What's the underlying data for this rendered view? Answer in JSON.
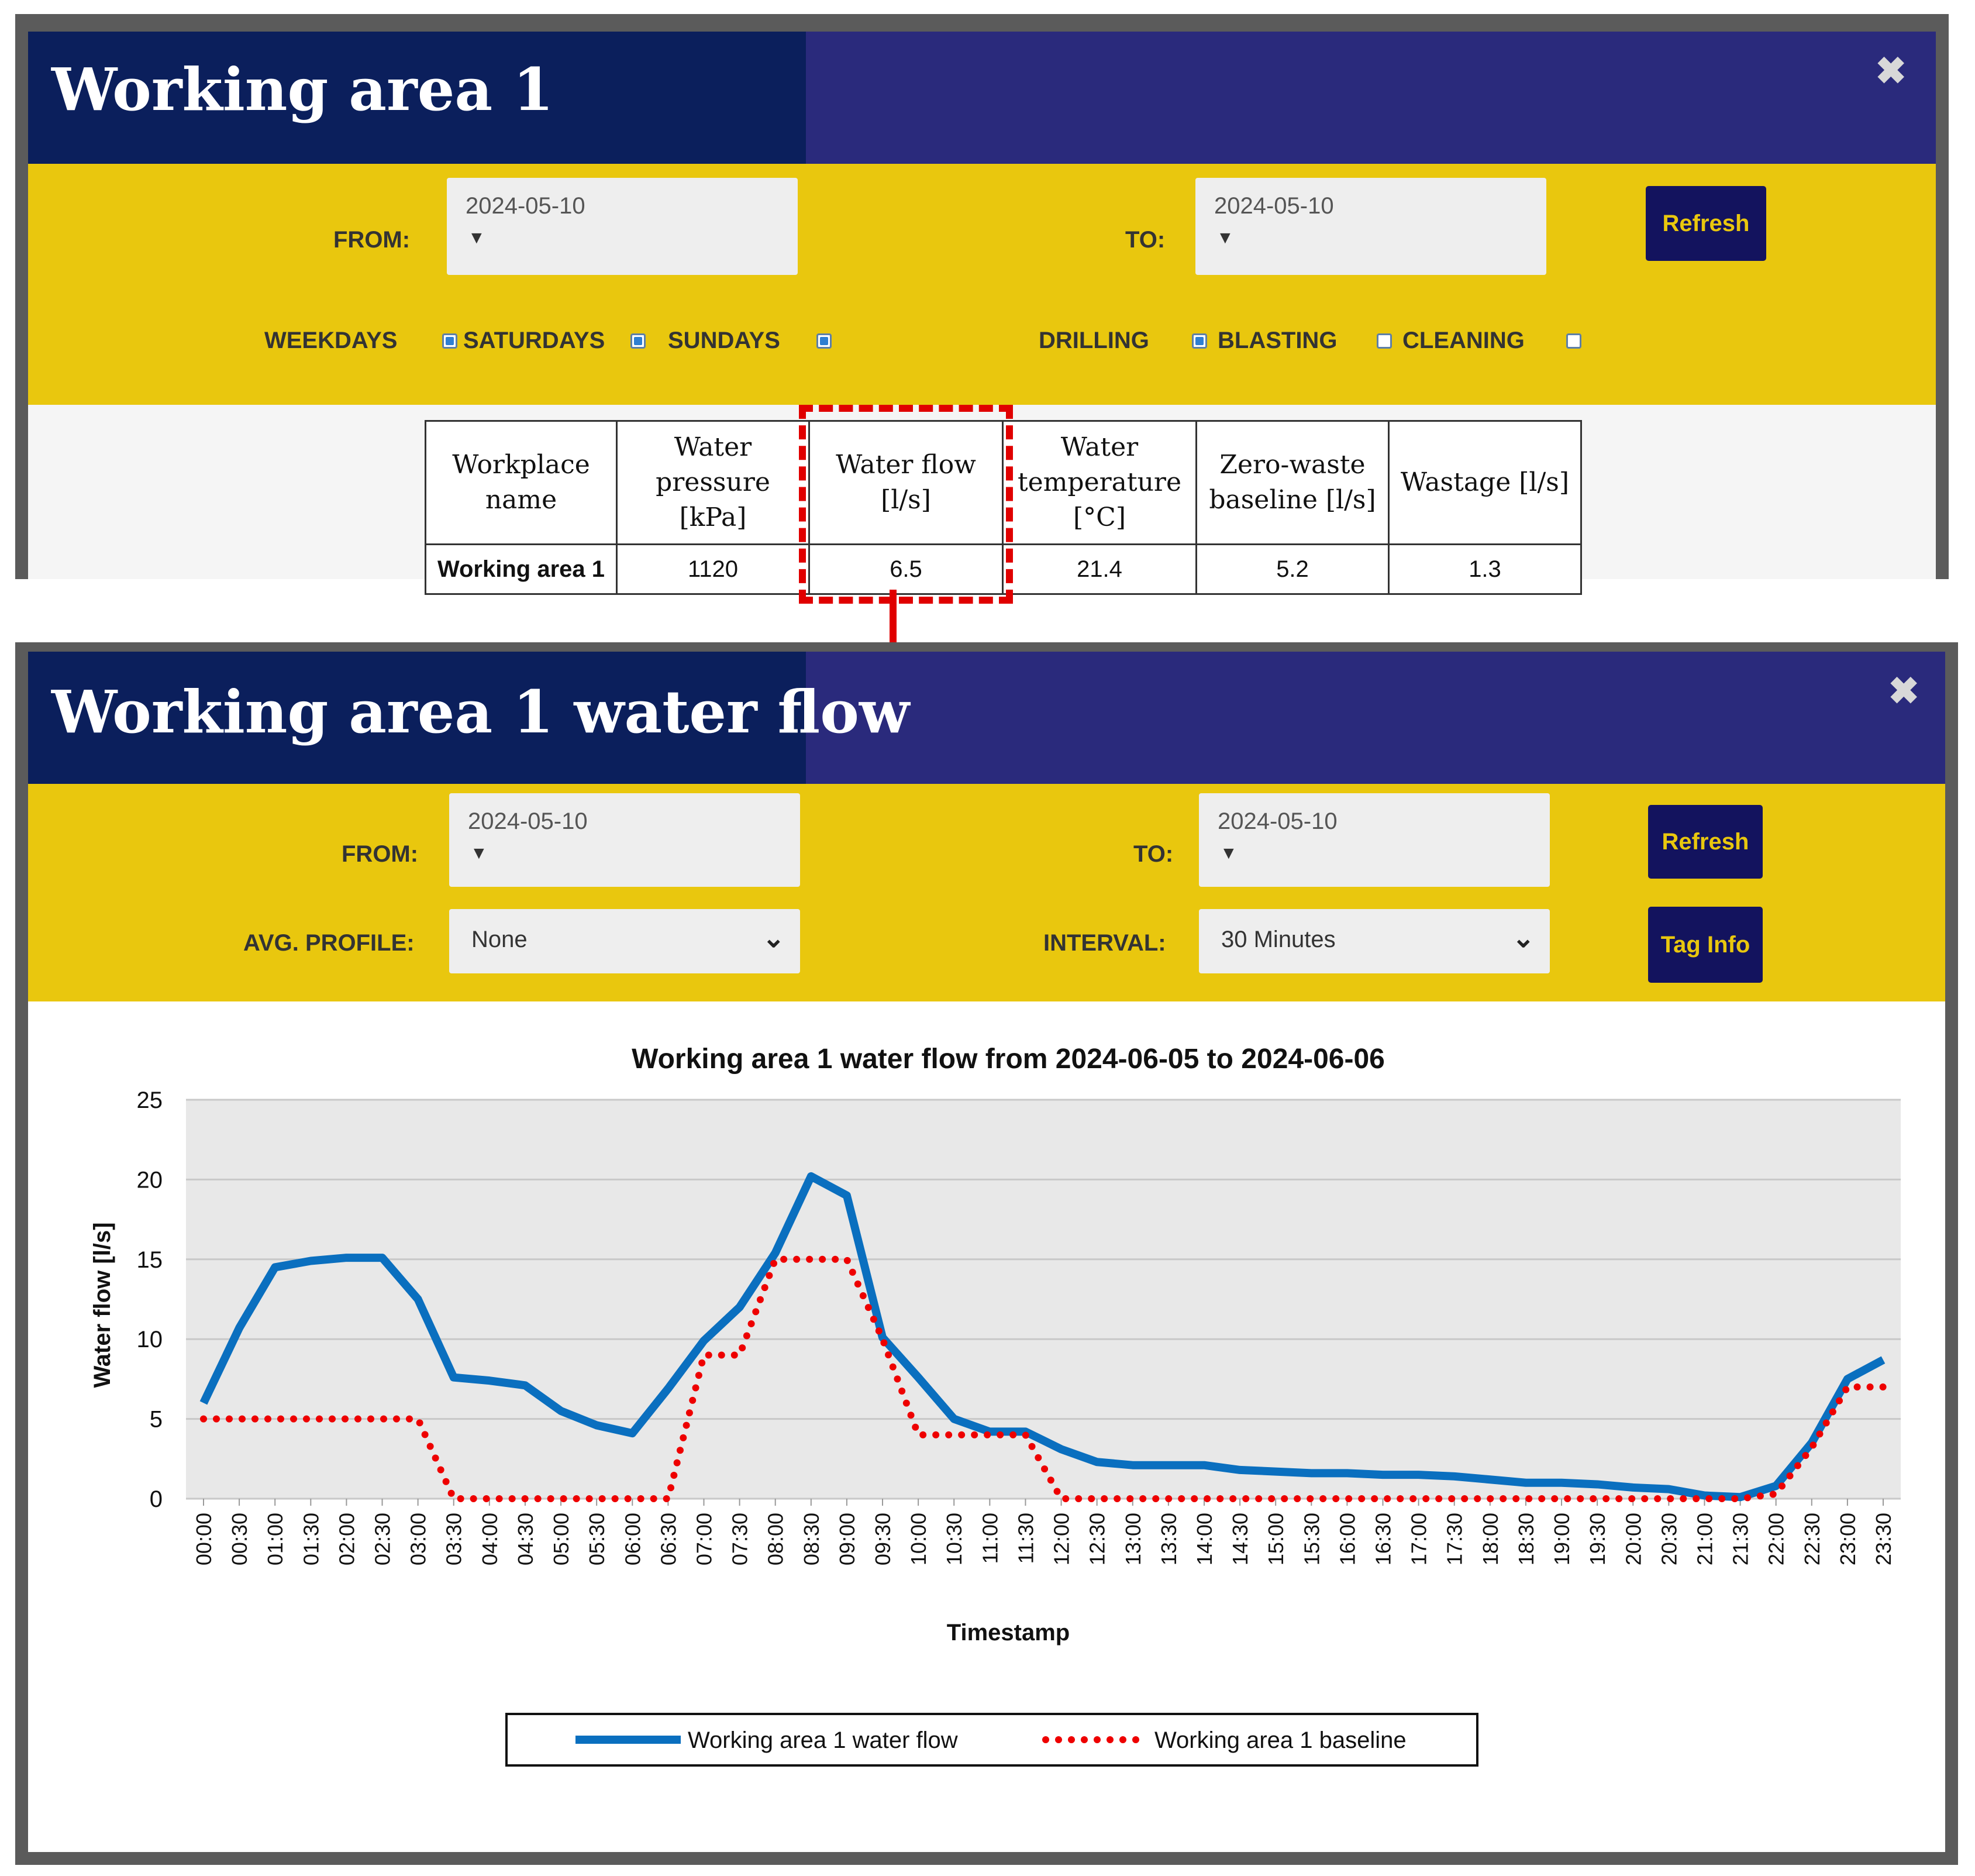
{
  "window1": {
    "title": "Working area 1",
    "close": "✖",
    "from_label": "FROM:",
    "from_value": "2024-05-10",
    "to_label": "TO:",
    "to_value": "2024-05-10",
    "dropdown_arrow": "▼",
    "refresh": "Refresh",
    "filters": {
      "weekdays": "WEEKDAYS",
      "saturdays": "SATURDAYS",
      "sundays": "SUNDAYS",
      "drilling": "DRILLING",
      "blasting": "BLASTING",
      "cleaning": "CLEANING"
    },
    "table": {
      "headers": [
        "Workplace name",
        "Water pressure [kPa]",
        "Water flow [l/s]",
        "Water temperature [°C]",
        "Zero-waste baseline [l/s]",
        "Wastage [l/s]"
      ],
      "row": [
        "Working area 1",
        "1120",
        "6.5",
        "21.4",
        "5.2",
        "1.3"
      ]
    }
  },
  "window2": {
    "title": "Working area 1 water flow",
    "close": "✖",
    "from_label": "FROM:",
    "from_value": "2024-05-10",
    "to_label": "TO:",
    "to_value": "2024-05-10",
    "dropdown_arrow": "▼",
    "refresh": "Refresh",
    "tag_info": "Tag Info",
    "avg_profile_label": "AVG. PROFILE:",
    "avg_profile_value": "None",
    "interval_label": "INTERVAL:",
    "interval_value": "30 Minutes",
    "chevron": "⌄"
  },
  "colors": {
    "navy": "#0b1f5c",
    "yellow": "#e9c70e",
    "flow": "#0a6fbf",
    "baseline": "#ee0000"
  },
  "chart_data": {
    "type": "line",
    "title": "Working area 1 water flow from 2024-06-05 to 2024-06-06",
    "xlabel": "Timestamp",
    "ylabel": "Water flow [l/s]",
    "ylim": [
      0,
      25
    ],
    "yticks": [
      0,
      5,
      10,
      15,
      20,
      25
    ],
    "grid": true,
    "legend_position": "bottom",
    "categories": [
      "00:00",
      "00:30",
      "01:00",
      "01:30",
      "02:00",
      "02:30",
      "03:00",
      "03:30",
      "04:00",
      "04:30",
      "05:00",
      "05:30",
      "06:00",
      "06:30",
      "07:00",
      "07:30",
      "08:00",
      "08:30",
      "09:00",
      "09:30",
      "10:00",
      "10:30",
      "11:00",
      "11:30",
      "12:00",
      "12:30",
      "13:00",
      "13:30",
      "14:00",
      "14:30",
      "15:00",
      "15:30",
      "16:00",
      "16:30",
      "17:00",
      "17:30",
      "18:00",
      "18:30",
      "19:00",
      "19:30",
      "20:00",
      "20:30",
      "21:00",
      "21:30",
      "22:00",
      "22:30",
      "23:00",
      "23:30"
    ],
    "series": [
      {
        "name": "Working area 1 water flow",
        "style": "solid",
        "values": [
          6.0,
          10.7,
          14.5,
          14.9,
          15.1,
          15.1,
          12.5,
          7.6,
          7.4,
          7.1,
          5.5,
          4.6,
          4.1,
          6.9,
          9.9,
          12.0,
          15.4,
          20.2,
          19.0,
          10.1,
          7.6,
          5.0,
          4.2,
          4.2,
          3.1,
          2.3,
          2.1,
          2.1,
          2.1,
          1.8,
          1.7,
          1.6,
          1.6,
          1.5,
          1.5,
          1.4,
          1.2,
          1.0,
          1.0,
          0.9,
          0.7,
          0.6,
          0.2,
          0.1,
          0.8,
          3.5,
          7.5,
          8.7
        ]
      },
      {
        "name": "Working area 1 baseline",
        "style": "dotted",
        "values": [
          5,
          5,
          5,
          5,
          5,
          5,
          5,
          0,
          0,
          0,
          0,
          0,
          0,
          0,
          9,
          9,
          15,
          15,
          15,
          10,
          4,
          4,
          4,
          4,
          0,
          0,
          0,
          0,
          0,
          0,
          0,
          0,
          0,
          0,
          0,
          0,
          0,
          0,
          0,
          0,
          0,
          0,
          0,
          0,
          0.3,
          3.2,
          7.0,
          7.0
        ]
      }
    ]
  }
}
